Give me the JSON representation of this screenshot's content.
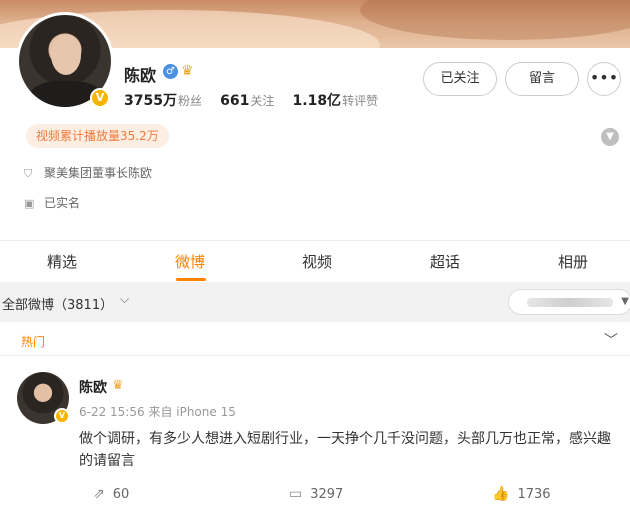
{
  "profile": {
    "name": "陈欧",
    "verified_badge": "V",
    "gender_icon": "male-icon",
    "crown_icon": "crown-icon",
    "stats": [
      {
        "value": "3755万",
        "label": "粉丝"
      },
      {
        "value": "661",
        "label": "关注"
      },
      {
        "value": "1.18亿",
        "label": "转评赞"
      }
    ],
    "buttons": {
      "follow": "已关注",
      "message": "留言",
      "more": "•••"
    },
    "play_count": "视频累计播放量35.2万",
    "info": [
      {
        "icon": "shield-icon",
        "text": "聚美集团董事长陈欧"
      },
      {
        "icon": "id-card-icon",
        "text": "已实名"
      }
    ]
  },
  "tabs": [
    "精选",
    "微博",
    "视频",
    "超话",
    "相册"
  ],
  "active_tab": "微博",
  "filter": {
    "label": "全部微博（3811）",
    "caret": "⌵"
  },
  "section": {
    "hot_label": "热门"
  },
  "post": {
    "author": "陈欧",
    "meta": "6-22 15:56  来自 iPhone 15",
    "text": "做个调研，有多少人想进入短剧行业，一天挣个几千没问题，头部几万也正常，感兴趣的请留言",
    "reposts": "60",
    "comments": "3297",
    "likes": "1736"
  },
  "colors": {
    "accent": "#ff8200",
    "badge_bg": "#fdeee4",
    "badge_text": "#f07a3a",
    "verified": "#f7b500"
  }
}
